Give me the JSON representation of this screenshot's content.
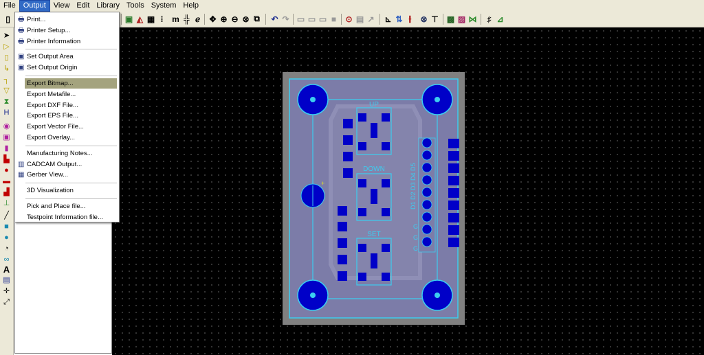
{
  "menu_bar": [
    "File",
    "Output",
    "View",
    "Edit",
    "Library",
    "Tools",
    "System",
    "Help"
  ],
  "active_menu": "Output",
  "output_menu": {
    "groups": [
      [
        {
          "label": "Print...",
          "icon": "printer-icon"
        },
        {
          "label": "Printer Setup...",
          "icon": "printer-setup-icon"
        },
        {
          "label": "Printer Information",
          "icon": "printer-info-icon"
        }
      ],
      [
        {
          "label": "Set Output Area",
          "icon": "output-area-icon"
        },
        {
          "label": "Set Output Origin",
          "icon": "output-origin-icon"
        }
      ],
      [
        {
          "label": "Export Bitmap...",
          "highlighted": true
        },
        {
          "label": "Export Metafile..."
        },
        {
          "label": "Export DXF File..."
        },
        {
          "label": "Export EPS File..."
        },
        {
          "label": "Export Vector File..."
        },
        {
          "label": "Export Overlay..."
        }
      ],
      [
        {
          "label": "Manufacturing Notes..."
        },
        {
          "label": "CADCAM Output...",
          "icon": "cadcam-icon"
        },
        {
          "label": "Gerber View...",
          "icon": "gerber-icon"
        }
      ],
      [
        {
          "label": "3D Visualization"
        }
      ],
      [
        {
          "label": "Pick and Place file..."
        },
        {
          "label": "Testpoint Information file..."
        }
      ]
    ]
  },
  "pcb_labels": {
    "up": "UP",
    "down": "DOWN",
    "set": "SET",
    "vertical": "D1 D2 D3 D4 D5",
    "side_letters": [
      "G",
      "G",
      "G"
    ]
  },
  "colors": {
    "canvas": "#000000",
    "board": "#808080",
    "copper": "#0000c8",
    "outline": "#3ccdf0",
    "highlight": "#a4a37e",
    "menu_active": "#316ac5"
  }
}
